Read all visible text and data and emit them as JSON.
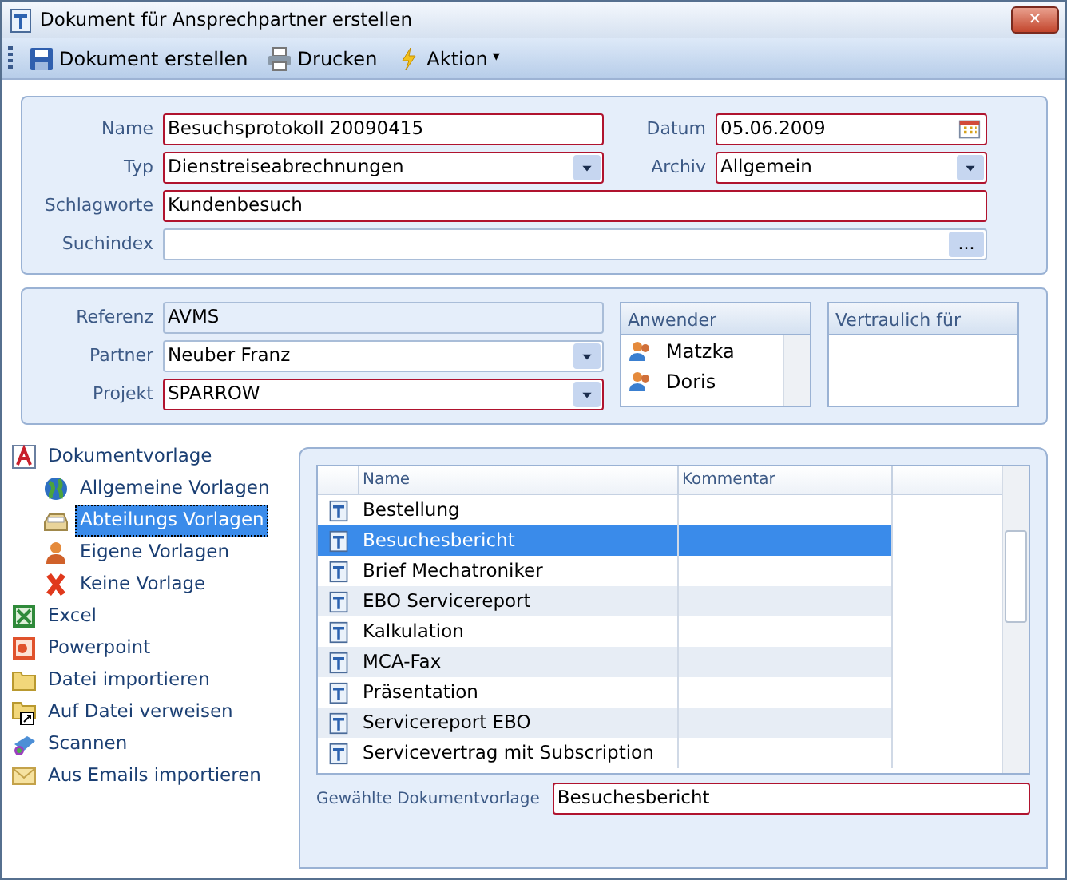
{
  "window": {
    "title": "Dokument für Ansprechpartner erstellen",
    "close": "✕"
  },
  "toolbar": [
    {
      "kind": "save",
      "label": "Dokument erstellen"
    },
    {
      "kind": "print",
      "label": "Drucken"
    },
    {
      "kind": "action",
      "label": "Aktion",
      "caret": "▾"
    }
  ],
  "document_panel": {
    "fields": [
      {
        "kind": "text",
        "label": "Name",
        "value": "Besuchsprotokoll 20090415",
        "required": true
      },
      {
        "kind": "date",
        "label": "Datum",
        "value": "05.06.2009",
        "required": true
      },
      {
        "kind": "dropdown",
        "label": "Typ",
        "value": "Dienstreiseabrechnungen",
        "required": true
      },
      {
        "kind": "dropdown",
        "label": "Archiv",
        "value": "Allgemein",
        "required": true
      },
      {
        "kind": "text",
        "label": "Schlagworte",
        "value": "Kundenbesuch",
        "required": true
      },
      {
        "kind": "browse",
        "label": "Suchindex",
        "button": "...",
        "required": false
      }
    ]
  },
  "reference_panel": {
    "fields": [
      {
        "kind": "readonly",
        "label": "Referenz",
        "value": "AVMS",
        "required": false
      },
      {
        "kind": "dropdown",
        "label": "Partner",
        "value": "Neuber Franz",
        "required": false
      },
      {
        "kind": "dropdown",
        "label": "Projekt",
        "value": "SPARROW",
        "required": true
      }
    ],
    "users": {
      "title": "Anwender",
      "items": [
        "Matzka",
        "Doris"
      ]
    },
    "confidential": {
      "title": "Vertraulich für"
    }
  },
  "sidebar": {
    "items": [
      {
        "kind": "template",
        "label": "Dokumentvorlage",
        "selected": false,
        "children": [
          {
            "kind": "globe",
            "label": "Allgemeine Vorlagen",
            "selected": false
          },
          {
            "kind": "tray",
            "label": "Abteilungs Vorlagen",
            "selected": true
          },
          {
            "kind": "person",
            "label": "Eigene Vorlagen",
            "selected": false
          },
          {
            "kind": "cross",
            "label": "Keine Vorlage",
            "selected": false
          }
        ]
      },
      {
        "kind": "excel",
        "label": "Excel",
        "selected": false
      },
      {
        "kind": "powerpoint",
        "label": "Powerpoint",
        "selected": false
      },
      {
        "kind": "folder",
        "label": "Datei importieren",
        "selected": false
      },
      {
        "kind": "link",
        "label": "Auf Datei verweisen",
        "selected": false
      },
      {
        "kind": "scan",
        "label": "Scannen",
        "selected": false
      },
      {
        "kind": "mail",
        "label": "Aus Emails importieren",
        "selected": false
      }
    ]
  },
  "table": {
    "columns": [
      "Name",
      "Kommentar"
    ],
    "rows": [
      {
        "name": "Bestellung",
        "selected": false
      },
      {
        "name": "Besuchesbericht",
        "selected": true
      },
      {
        "name": "Brief Mechatroniker",
        "selected": false
      },
      {
        "name": "EBO Servicereport",
        "selected": false
      },
      {
        "name": "Kalkulation",
        "selected": false
      },
      {
        "name": "MCA-Fax",
        "selected": false
      },
      {
        "name": "Präsentation",
        "selected": false
      },
      {
        "name": "Servicereport EBO",
        "selected": false
      },
      {
        "name": "Servicevertrag mit Subscription",
        "selected": false
      }
    ]
  },
  "chosen_template": {
    "label": "Gewählte Dokumentvorlage",
    "value": "Besuchesbericht",
    "required": true
  }
}
